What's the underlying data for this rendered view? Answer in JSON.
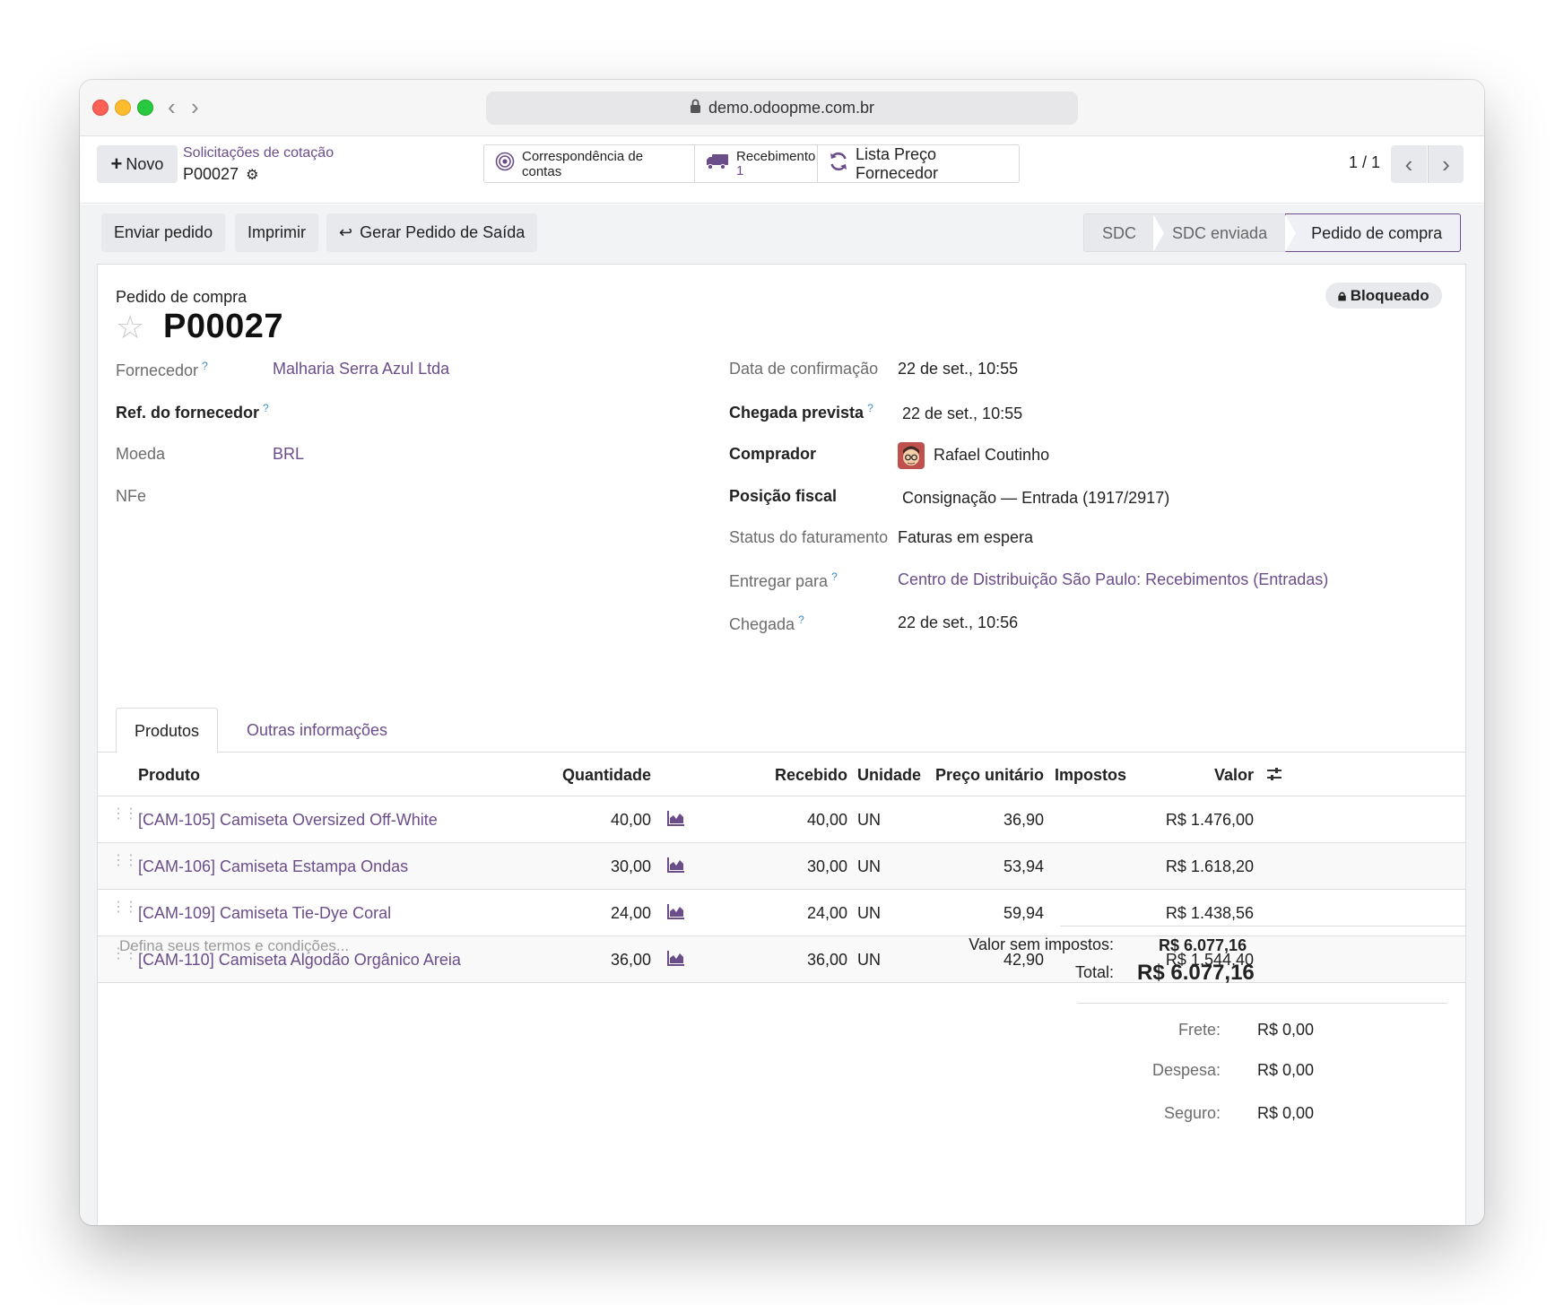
{
  "browser": {
    "url": "demo.odoopme.com.br"
  },
  "control_panel": {
    "new_button": "Novo",
    "breadcrumb_parent": "Solicitações de cotação",
    "breadcrumb_current": "P00027",
    "smart_buttons": [
      {
        "label": "Correspondência de contas",
        "icon": "target-icon"
      },
      {
        "label": "Recebimento",
        "count": "1",
        "icon": "truck-icon"
      },
      {
        "label": "Lista Preço Fornecedor",
        "icon": "refresh-icon"
      }
    ],
    "pager": "1 / 1"
  },
  "actions": {
    "send": "Enviar pedido",
    "print": "Imprimir",
    "generate": "Gerar Pedido de Saída"
  },
  "stages": [
    {
      "label": "SDC",
      "active": false
    },
    {
      "label": "SDC enviada",
      "active": false
    },
    {
      "label": "Pedido de compra",
      "active": true
    }
  ],
  "record": {
    "label": "Pedido de compra",
    "name": "P00027",
    "lock_badge": "Bloqueado"
  },
  "left_fields": [
    {
      "label": "Fornecedor",
      "help": "?",
      "value": "Malharia Serra Azul Ltda"
    },
    {
      "label": "Ref. do fornecedor",
      "help": "?",
      "value": ""
    },
    {
      "label": "Moeda",
      "value": "BRL"
    },
    {
      "label": "NFe",
      "value": ""
    }
  ],
  "right_fields": [
    {
      "label": "Data de confirmação",
      "value": "22 de set., 10:55"
    },
    {
      "label": "Chegada prevista",
      "help": "?",
      "value": "22 de set., 10:55"
    },
    {
      "label": "Comprador",
      "value": "Rafael Coutinho"
    },
    {
      "label": "Posição fiscal",
      "value": "Consignação — Entrada (1917/2917)"
    },
    {
      "label": "Status do faturamento",
      "value": "Faturas em espera"
    },
    {
      "label": "Entregar para",
      "help": "?",
      "value": "Centro de Distribuição São Paulo: Recebimentos (Entradas)"
    },
    {
      "label": "Chegada",
      "help": "?",
      "value": "22 de set., 10:56"
    }
  ],
  "tabs": [
    "Produtos",
    "Outras informações"
  ],
  "table": {
    "headers": [
      "Produto",
      "Quantidade",
      "Recebido",
      "Unidade",
      "Preço unitário",
      "Impostos",
      "Valor"
    ],
    "rows": [
      {
        "product": "[CAM-105] Camiseta Oversized Off-White",
        "qty": "40,00",
        "received": "40,00",
        "uom": "UN",
        "price": "36,90",
        "taxes": "",
        "value": "R$ 1.476,00"
      },
      {
        "product": "[CAM-106] Camiseta Estampa Ondas",
        "qty": "30,00",
        "received": "30,00",
        "uom": "UN",
        "price": "53,94",
        "taxes": "",
        "value": "R$ 1.618,20"
      },
      {
        "product": "[CAM-109] Camiseta Tie-Dye Coral",
        "qty": "24,00",
        "received": "24,00",
        "uom": "UN",
        "price": "59,94",
        "taxes": "",
        "value": "R$ 1.438,56"
      },
      {
        "product": "[CAM-110] Camiseta Algodão Orgânico Areia",
        "qty": "36,00",
        "received": "36,00",
        "uom": "UN",
        "price": "42,90",
        "taxes": "",
        "value": "R$ 1.544,40"
      }
    ]
  },
  "terms_placeholder": "Defina seus termos e condições...",
  "totals": {
    "untaxed_label": "Valor sem impostos:",
    "untaxed_value": "R$ 6.077,16",
    "total_label": "Total:",
    "total_value": "R$ 6.077,16"
  },
  "extras": [
    {
      "label": "Frete:",
      "value": "R$ 0,00"
    },
    {
      "label": "Despesa:",
      "value": "R$ 0,00"
    },
    {
      "label": "Seguro:",
      "value": "R$ 0,00"
    }
  ],
  "colors": {
    "accent": "#6b4d8a",
    "help": "#3a8fc8"
  }
}
